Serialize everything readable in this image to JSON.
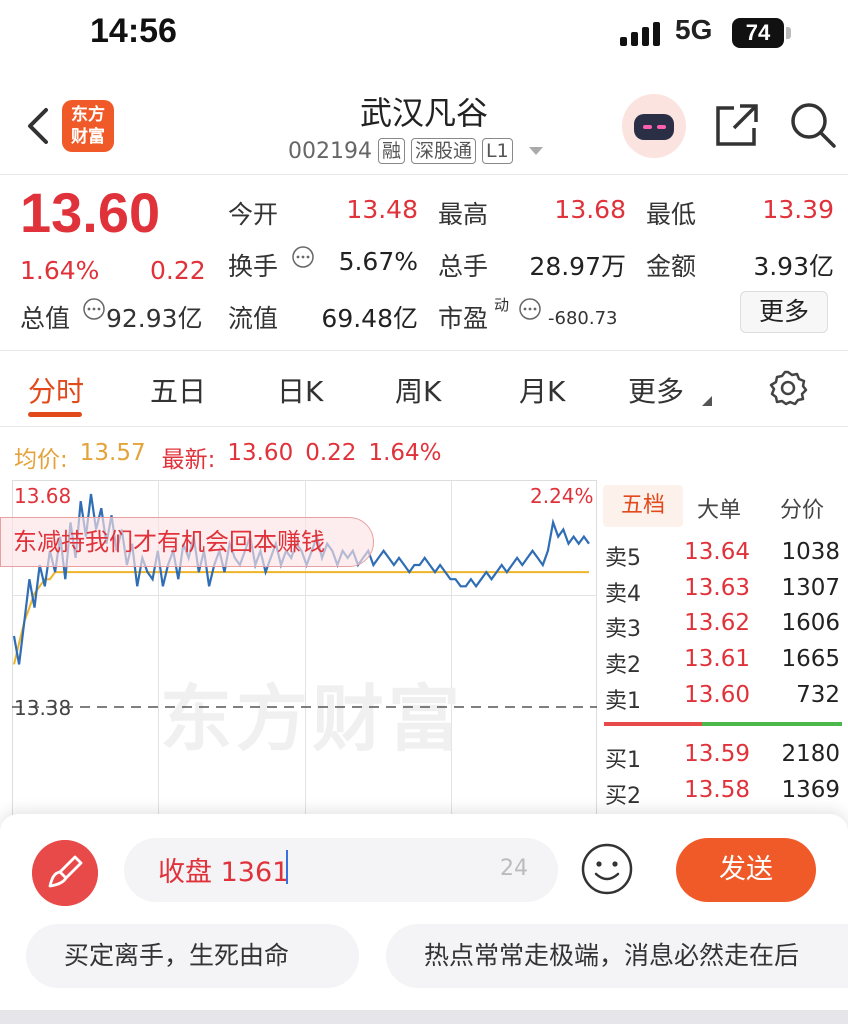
{
  "status": {
    "time": "14:56",
    "network": "5G",
    "battery": "74"
  },
  "header": {
    "logo_line1": "东方",
    "logo_line2": "财富",
    "stock_name": "武汉凡谷",
    "stock_code": "002194",
    "tags": [
      "融",
      "深股通",
      "L1"
    ]
  },
  "quote": {
    "price": "13.60",
    "change_pct": "1.64%",
    "change": "0.22",
    "mkt_cap_label": "总值",
    "mkt_cap": "92.93亿",
    "fields": [
      {
        "label": "今开",
        "value": "13.48",
        "red": true
      },
      {
        "label": "最高",
        "value": "13.68",
        "red": true
      },
      {
        "label": "最低",
        "value": "13.39",
        "red": true
      },
      {
        "label": "换手",
        "value": "5.67%",
        "red": false
      },
      {
        "label": "总手",
        "value": "28.97万",
        "red": false
      },
      {
        "label": "金额",
        "value": "3.93亿",
        "red": false
      },
      {
        "label": "流值",
        "value": "69.48亿",
        "red": false
      }
    ],
    "pe_label": "市盈",
    "pe_sup": "动",
    "pe_value": "-680.73",
    "more_label": "更多"
  },
  "tabs": [
    "分时",
    "五日",
    "日K",
    "周K",
    "月K",
    "更多"
  ],
  "chart_header": {
    "avg_label": "均价:",
    "avg_value": "13.57",
    "latest_label": "最新:",
    "latest_value": "13.60",
    "latest_change": "0.22",
    "latest_pct": "1.64%"
  },
  "chart_labels": {
    "high": "13.68",
    "pct": "2.24%",
    "base": "13.38"
  },
  "watermark": "东方财富",
  "danmu": "东减持我们才有机会回本赚钱",
  "side_tabs": [
    "五档",
    "大单",
    "分价"
  ],
  "order_book": {
    "asks": [
      {
        "label": "卖5",
        "price": "13.64",
        "volume": "1038"
      },
      {
        "label": "卖4",
        "price": "13.63",
        "volume": "1307"
      },
      {
        "label": "卖3",
        "price": "13.62",
        "volume": "1606"
      },
      {
        "label": "卖2",
        "price": "13.61",
        "volume": "1665"
      },
      {
        "label": "卖1",
        "price": "13.60",
        "volume": "732"
      }
    ],
    "bids": [
      {
        "label": "买1",
        "price": "13.59",
        "volume": "2180"
      },
      {
        "label": "买2",
        "price": "13.58",
        "volume": "1369"
      }
    ]
  },
  "comment": {
    "input_value": "收盘 1361",
    "remaining": "24",
    "send_label": "发送",
    "quick_replies": [
      "买定离手，生死由命",
      "热点常常走极端，消息必然走在后"
    ]
  },
  "colors": {
    "up_red": "#e0323a",
    "brand_orange": "#f05a28",
    "avg_line": "#f0b429",
    "price_line": "#2f6db5"
  },
  "chart_data": {
    "type": "line",
    "ylim": [
      13.38,
      13.68
    ],
    "series": [
      {
        "values": [
          13.48,
          13.44,
          13.5,
          13.56,
          13.52,
          13.58,
          13.55,
          13.6,
          13.57,
          13.62,
          13.56,
          13.64,
          13.59,
          13.67,
          13.62,
          13.68,
          13.63,
          13.66,
          13.61,
          13.65,
          13.6,
          13.63,
          13.58,
          13.61,
          13.55,
          13.59,
          13.57,
          13.56,
          13.6,
          13.55,
          13.58,
          13.6,
          13.56,
          13.61,
          13.59,
          13.62,
          13.57,
          13.6,
          13.55,
          13.58,
          13.6,
          13.57,
          13.61,
          13.59,
          13.58,
          13.6,
          13.62,
          13.58,
          13.6,
          13.57,
          13.59,
          13.61,
          13.58,
          13.6,
          13.59,
          13.61,
          13.6,
          13.58,
          13.6,
          13.62,
          13.59,
          13.61,
          13.6,
          13.58,
          13.6,
          13.59,
          13.6,
          13.58,
          13.59,
          13.6,
          13.58,
          13.59,
          13.6,
          13.59,
          13.58,
          13.59,
          13.58,
          13.57,
          13.58,
          13.58,
          13.59,
          13.58,
          13.57,
          13.58,
          13.57,
          13.56,
          13.56,
          13.55,
          13.55,
          13.56,
          13.55,
          13.56,
          13.57,
          13.56,
          13.57,
          13.58,
          13.57,
          13.58,
          13.59,
          13.58,
          13.59,
          13.6,
          13.59,
          13.58,
          13.6,
          13.64,
          13.62,
          13.63,
          13.61,
          13.62,
          13.61,
          13.62,
          13.61
        ]
      },
      {
        "values": [
          13.44,
          13.47,
          13.5,
          13.52,
          13.54,
          13.55,
          13.56,
          13.56,
          13.57,
          13.57,
          13.57,
          13.57,
          13.57,
          13.57,
          13.57,
          13.57,
          13.57,
          13.57,
          13.57,
          13.57,
          13.57,
          13.57,
          13.57,
          13.57,
          13.57,
          13.57,
          13.57,
          13.57,
          13.57,
          13.57,
          13.57,
          13.57,
          13.57,
          13.57,
          13.57,
          13.57,
          13.57,
          13.57,
          13.57,
          13.57,
          13.57,
          13.57,
          13.57,
          13.57,
          13.57,
          13.57,
          13.57,
          13.57,
          13.57,
          13.57,
          13.57,
          13.57,
          13.57,
          13.57,
          13.57,
          13.57,
          13.57,
          13.57,
          13.57,
          13.57,
          13.57,
          13.57,
          13.57,
          13.57,
          13.57,
          13.57,
          13.57,
          13.57,
          13.57,
          13.57,
          13.57,
          13.57,
          13.57,
          13.57,
          13.57,
          13.57,
          13.57,
          13.57,
          13.57,
          13.57,
          13.57,
          13.57,
          13.57,
          13.57,
          13.57,
          13.57,
          13.57,
          13.57,
          13.57,
          13.57,
          13.57,
          13.57,
          13.57,
          13.57,
          13.57,
          13.57,
          13.57,
          13.57,
          13.57,
          13.57,
          13.57,
          13.57,
          13.57,
          13.57,
          13.57,
          13.57,
          13.57,
          13.57,
          13.57,
          13.57,
          13.57,
          13.57,
          13.57
        ]
      }
    ]
  }
}
